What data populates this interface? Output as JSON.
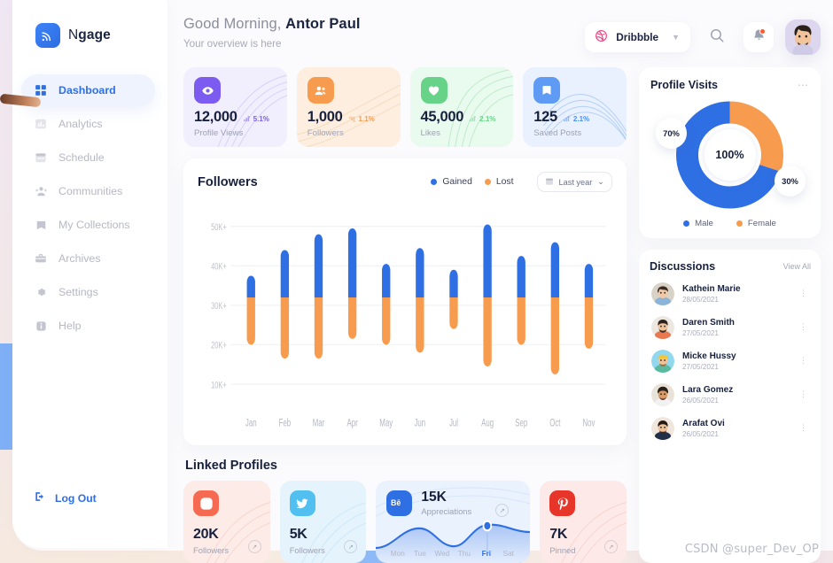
{
  "brand": {
    "name_light": "N",
    "name_bold": "gage",
    "logo_icon": "signal-broadcast-icon"
  },
  "sidebar": {
    "items": [
      {
        "label": "Dashboard",
        "icon": "grid-icon",
        "active": true
      },
      {
        "label": "Analytics",
        "icon": "bar-chart-icon",
        "active": false
      },
      {
        "label": "Schedule",
        "icon": "calendar-icon",
        "active": false
      },
      {
        "label": "Communities",
        "icon": "people-group-icon",
        "active": false
      },
      {
        "label": "My Collections",
        "icon": "bookmark-icon",
        "active": false
      },
      {
        "label": "Archives",
        "icon": "briefcase-icon",
        "active": false
      },
      {
        "label": "Settings",
        "icon": "gear-icon",
        "active": false
      },
      {
        "label": "Help",
        "icon": "info-icon",
        "active": false
      }
    ],
    "logout": {
      "label": "Log Out",
      "icon": "logout-icon"
    }
  },
  "topbar": {
    "greeting_prefix": "Good Morning,",
    "user_name": "Antor Paul",
    "subtitle": "Your overview is here",
    "brand_select": {
      "label": "Dribbble",
      "icon": "dribbble-icon",
      "caret": "▼"
    },
    "search_icon": "search-icon",
    "bell_icon": "bell-icon",
    "avatar": "user-avatar"
  },
  "stats": [
    {
      "value": "12,000",
      "label": "Profile Views",
      "delta": "5.1%",
      "direction": "up",
      "icon": "eye-icon",
      "icon_bg": "#7c5cf0",
      "card_bg": "#f1eefd",
      "accent": "#7c5cf0"
    },
    {
      "value": "1,000",
      "label": "Followers",
      "delta": "1.1%",
      "direction": "down",
      "icon": "people-icon",
      "icon_bg": "#f79b4e",
      "card_bg": "#fdeee0",
      "accent": "#f79b4e"
    },
    {
      "value": "45,000",
      "label": "Likes",
      "delta": "2.1%",
      "direction": "up",
      "icon": "heart-icon",
      "icon_bg": "#67d389",
      "card_bg": "#e9faee",
      "accent": "#67d389"
    },
    {
      "value": "125",
      "label": "Saved Posts",
      "delta": "2.1%",
      "direction": "up",
      "icon": "bookmark-icon",
      "icon_bg": "#5f9bf5",
      "card_bg": "#e9f1fe",
      "accent": "#4a8df3"
    }
  ],
  "followers_panel": {
    "title": "Followers",
    "legend": [
      {
        "label": "Gained",
        "color": "#2f6fe4"
      },
      {
        "label": "Lost",
        "color": "#f79b4e"
      }
    ],
    "range_select": {
      "label": "Last year",
      "icon": "calendar-icon",
      "caret": "⌄"
    }
  },
  "chart_data": {
    "type": "bar",
    "title": "Followers",
    "subtype": "floating-range-bar",
    "xlabel": "",
    "ylabel": "",
    "ylim": [
      5000,
      55000
    ],
    "grid": true,
    "legend_position": "top-right",
    "yticks": [
      10000,
      20000,
      30000,
      40000,
      50000
    ],
    "ytick_labels": [
      "10K+",
      "20K+",
      "30K+",
      "40K+",
      "50K+"
    ],
    "categories": [
      "Jan",
      "Feb",
      "Mar",
      "Apr",
      "May",
      "Jun",
      "Jul",
      "Aug",
      "Sep",
      "Oct",
      "Nov"
    ],
    "split_value": 32000,
    "series": [
      {
        "name": "Gained",
        "color": "#2f6fe4",
        "tops": [
          37500,
          44000,
          48000,
          49500,
          40500,
          44500,
          39000,
          50500,
          42500,
          46000,
          40500
        ]
      },
      {
        "name": "Lost",
        "color": "#f79b4e",
        "bottoms": [
          20000,
          16500,
          16500,
          21500,
          20000,
          18000,
          24000,
          14500,
          20000,
          12500,
          19000
        ]
      }
    ]
  },
  "linked_profiles": {
    "title": "Linked Profiles",
    "items": [
      {
        "network": "instagram",
        "icon": "instagram-icon",
        "value": "20K",
        "label": "Followers",
        "icon_bg": "#f76a52",
        "card_bg": "#fdebe7",
        "wide": false
      },
      {
        "network": "twitter",
        "icon": "twitter-icon",
        "value": "5K",
        "label": "Followers",
        "icon_bg": "#51c0f0",
        "card_bg": "#e4f3fc",
        "wide": false
      },
      {
        "network": "behance",
        "icon": "behance-icon",
        "value": "15K",
        "label": "Appreciations",
        "icon_bg": "#2f6fe4",
        "card_bg": "#eaf2fe",
        "wide": true,
        "days": [
          "Mon",
          "Tue",
          "Wed",
          "Thu",
          "Fri",
          "Sat"
        ],
        "active_day": "Fri"
      },
      {
        "network": "pinterest",
        "icon": "pinterest-icon",
        "value": "7K",
        "label": "Pinned",
        "icon_bg": "#e8352a",
        "card_bg": "#fdeae8",
        "wide": false
      }
    ]
  },
  "profile_visits": {
    "title": "Profile Visits",
    "menu_icon": "more-dots-icon",
    "center_label": "100%",
    "segments": [
      {
        "label": "Male",
        "value": 70,
        "display": "70%",
        "color": "#2f6fe4"
      },
      {
        "label": "Female",
        "value": 30,
        "display": "30%",
        "color": "#f79b4e"
      }
    ]
  },
  "discussions": {
    "title": "Discussions",
    "view_all": "View All",
    "items": [
      {
        "name": "Kathein Marie",
        "date": "28/05/2021",
        "avatar_bg": "#d9d2c6",
        "avatar_skin": "#f0c9a8",
        "avatar_hair": "#3a2b22",
        "avatar_shirt": "#8ab4d8"
      },
      {
        "name": "Daren Smith",
        "date": "27/05/2021",
        "avatar_bg": "#ece7e0",
        "avatar_skin": "#eec39c",
        "avatar_hair": "#2d231c",
        "avatar_shirt": "#e8784f"
      },
      {
        "name": "Micke Hussy",
        "date": "27/05/2021",
        "avatar_bg": "#8fd8ef",
        "avatar_skin": "#f0c49a",
        "avatar_hair": "#f2c53d",
        "avatar_shirt": "#5bb9a0"
      },
      {
        "name": "Lara Gomez",
        "date": "26/05/2021",
        "avatar_bg": "#e9e2d8",
        "avatar_skin": "#d79a6a",
        "avatar_hair": "#2b2018",
        "avatar_shirt": "#f1f1f1"
      },
      {
        "name": "Arafat Ovi",
        "date": "26/05/2021",
        "avatar_bg": "#f0e6dc",
        "avatar_skin": "#eec09a",
        "avatar_hair": "#241b14",
        "avatar_shirt": "#22304a"
      }
    ]
  },
  "watermark": "CSDN @super_Dev_OP"
}
